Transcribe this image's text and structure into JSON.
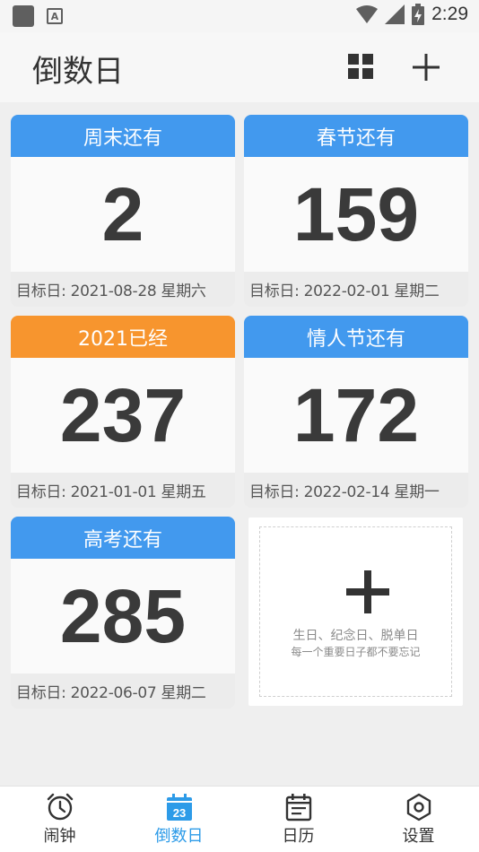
{
  "status_bar": {
    "time": "2:29",
    "a_glyph": "A"
  },
  "app": {
    "title": "倒数日"
  },
  "colors": {
    "blue": "#4299ee",
    "orange": "#f7952e",
    "accent": "#2d9be8"
  },
  "cards": [
    {
      "title": "周末还有",
      "days": "2",
      "target": "目标日: 2021-08-28 星期六",
      "color": "blue"
    },
    {
      "title": "春节还有",
      "days": "159",
      "target": "目标日: 2022-02-01 星期二",
      "color": "blue"
    },
    {
      "title": "2021已经",
      "days": "237",
      "target": "目标日: 2021-01-01 星期五",
      "color": "orange"
    },
    {
      "title": "情人节还有",
      "days": "172",
      "target": "目标日: 2022-02-14 星期一",
      "color": "blue"
    },
    {
      "title": "高考还有",
      "days": "285",
      "target": "目标日: 2022-06-07 星期二",
      "color": "blue"
    }
  ],
  "add_card": {
    "line1": "生日、纪念日、脱单日",
    "line2": "每一个重要日子都不要忘记"
  },
  "nav": {
    "items": [
      {
        "label": "闹钟",
        "icon": "alarm-clock-icon"
      },
      {
        "label": "倒数日",
        "icon": "calendar-23-icon",
        "badge": "23",
        "active": true
      },
      {
        "label": "日历",
        "icon": "calendar-list-icon"
      },
      {
        "label": "设置",
        "icon": "hexagon-settings-icon"
      }
    ]
  }
}
